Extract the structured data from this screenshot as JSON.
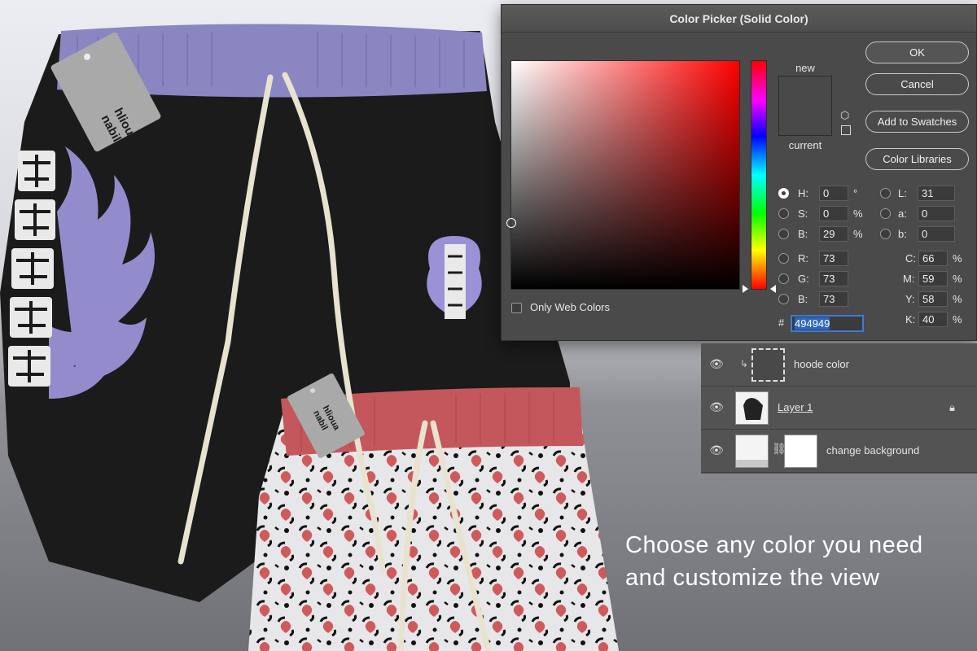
{
  "dialog": {
    "title": "Color Picker (Solid Color)",
    "new_label": "new",
    "current_label": "current",
    "new_color": "#494949",
    "current_color": "#494949",
    "buttons": {
      "ok": "OK",
      "cancel": "Cancel",
      "add_to_swatches": "Add to Swatches",
      "color_libraries": "Color Libraries"
    },
    "only_web_colors": {
      "label": "Only Web Colors",
      "checked": false
    },
    "hsb": [
      {
        "label": "H:",
        "value": "0",
        "unit": "°",
        "selected": true
      },
      {
        "label": "S:",
        "value": "0",
        "unit": "%",
        "selected": false
      },
      {
        "label": "B:",
        "value": "29",
        "unit": "%",
        "selected": false
      }
    ],
    "rgb": [
      {
        "label": "R:",
        "value": "73"
      },
      {
        "label": "G:",
        "value": "73"
      },
      {
        "label": "B:",
        "value": "73"
      }
    ],
    "lab": [
      {
        "label": "L:",
        "value": "31"
      },
      {
        "label": "a:",
        "value": "0"
      },
      {
        "label": "b:",
        "value": "0"
      }
    ],
    "cmyk": [
      {
        "label": "C:",
        "value": "66",
        "unit": "%"
      },
      {
        "label": "M:",
        "value": "59",
        "unit": "%"
      },
      {
        "label": "Y:",
        "value": "58",
        "unit": "%"
      },
      {
        "label": "K:",
        "value": "40",
        "unit": "%"
      }
    ],
    "hex_prefix": "#",
    "hex": "494949"
  },
  "layers": [
    {
      "name": "hoode color",
      "clipped": true,
      "underline": false,
      "locked": false
    },
    {
      "name": "Layer 1",
      "clipped": false,
      "underline": true,
      "locked": true
    },
    {
      "name": "change background",
      "clipped": false,
      "underline": false,
      "locked": false
    }
  ],
  "caption": {
    "line1": "Choose any color you need",
    "line2": "and customize the view"
  },
  "hangtag": {
    "line1": "nabil",
    "line2": "hlioua"
  },
  "colors": {
    "shorts_black": "#1b1b1b",
    "waistband_purple": "#8a86c2",
    "waistband_red": "#c4575b",
    "print_purple": "#9a92d6",
    "heart_red": "#cf5a5c",
    "drawstring": "#e9e2cf",
    "hangtag": "#a9a9aa"
  }
}
